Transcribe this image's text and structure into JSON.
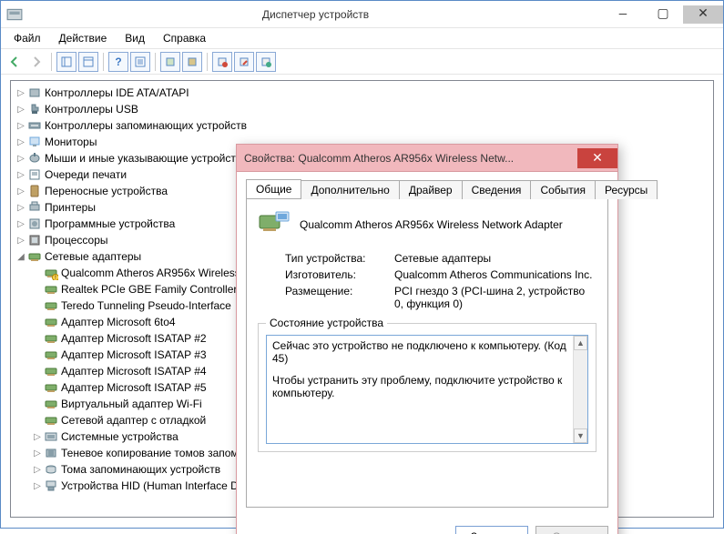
{
  "window": {
    "title": "Диспетчер устройств"
  },
  "menu": {
    "file": "Файл",
    "action": "Действие",
    "view": "Вид",
    "help": "Справка"
  },
  "tree": {
    "items": [
      {
        "label": "Контроллеры IDE ATA/ATAPI"
      },
      {
        "label": "Контроллеры USB"
      },
      {
        "label": "Контроллеры запоминающих устройств"
      },
      {
        "label": "Мониторы"
      },
      {
        "label": "Мыши и иные указывающие устройства"
      },
      {
        "label": "Очереди печати"
      },
      {
        "label": "Переносные устройства"
      },
      {
        "label": "Принтеры"
      },
      {
        "label": "Программные устройства"
      },
      {
        "label": "Процессоры"
      }
    ],
    "network": {
      "label": "Сетевые адаптеры",
      "children": [
        "Qualcomm Atheros AR956x Wireless Network Adapter",
        "Realtek PCIe GBE Family Controller",
        "Teredo Tunneling Pseudo-Interface",
        "Адаптер Microsoft 6to4",
        "Адаптер Microsoft ISATAP #2",
        "Адаптер Microsoft ISATAP #3",
        "Адаптер Microsoft ISATAP #4",
        "Адаптер Microsoft ISATAP #5",
        "Виртуальный адаптер Wi-Fi",
        "Сетевой адаптер с отладкой"
      ]
    },
    "tail": [
      "Системные устройства",
      "Теневое копирование томов запоминающих устройств",
      "Тома запоминающих устройств",
      "Устройства HID (Human Interface Devices)"
    ]
  },
  "dialog": {
    "title": "Свойства: Qualcomm Atheros AR956x Wireless Netw...",
    "tabs": {
      "general": "Общие",
      "advanced": "Дополнительно",
      "driver": "Драйвер",
      "details": "Сведения",
      "events": "События",
      "resources": "Ресурсы"
    },
    "device_name": "Qualcomm Atheros AR956x Wireless Network Adapter",
    "rows": {
      "type_k": "Тип устройства:",
      "type_v": "Сетевые адаптеры",
      "mfr_k": "Изготовитель:",
      "mfr_v": "Qualcomm Atheros Communications Inc.",
      "loc_k": "Размещение:",
      "loc_v": "PCI гнездо 3 (PCI-шина 2, устройство 0, функция 0)"
    },
    "status_legend": "Состояние устройства",
    "status_line1": "Сейчас это устройство не подключено к компьютеру. (Код 45)",
    "status_line2": "Чтобы устранить эту проблему, подключите устройство к компьютеру.",
    "close_btn": "Закрыть",
    "cancel_btn": "Отмена"
  }
}
